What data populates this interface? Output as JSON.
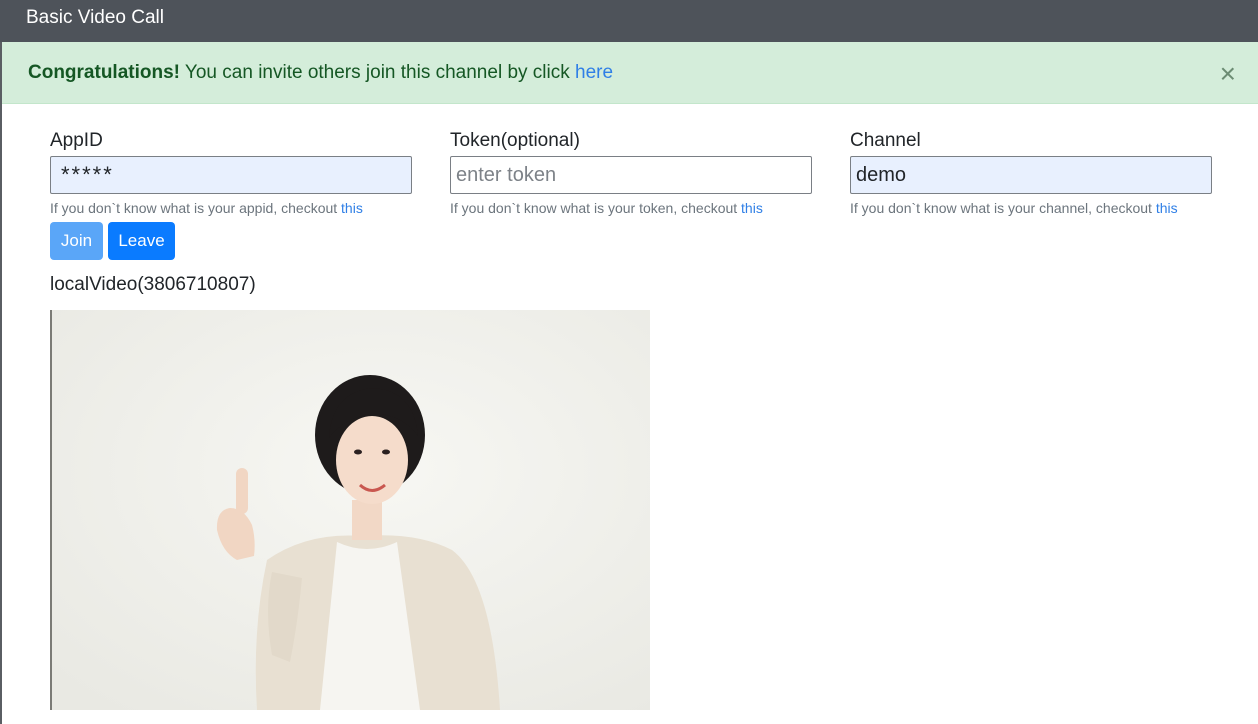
{
  "navbar": {
    "title": "Basic Video Call"
  },
  "alert": {
    "strong": "Congratulations!",
    "message": " You can invite others join this channel by click ",
    "link": "here",
    "close": "×"
  },
  "form": {
    "appid": {
      "label": "AppID",
      "value": "*****",
      "help": "If you don`t know what is your appid, checkout ",
      "help_link": "this"
    },
    "token": {
      "label": "Token(optional)",
      "value": "",
      "placeholder": "enter token",
      "help": "If you don`t know what is your token, checkout ",
      "help_link": "this"
    },
    "channel": {
      "label": "Channel",
      "value": "demo",
      "help": "If you don`t know what is your channel, checkout ",
      "help_link": "this"
    }
  },
  "buttons": {
    "join": "Join",
    "leave": "Leave"
  },
  "video": {
    "label": "localVideo(3806710807)"
  },
  "colors": {
    "navbar": "#4e535a",
    "alert_bg": "#d4edda",
    "alert_text": "#155724",
    "link": "#2f7fe6",
    "join_button": "#5aa6f8",
    "leave_button": "#0a7bff",
    "input_autofill": "#e8f0fe"
  }
}
